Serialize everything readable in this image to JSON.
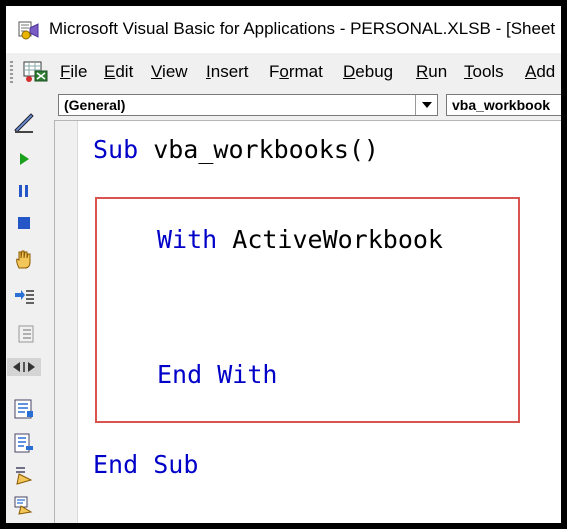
{
  "window": {
    "title": "Microsoft Visual Basic for Applications - PERSONAL.XLSB - [Sheet"
  },
  "menu": {
    "items": [
      {
        "key": "file",
        "text": "File"
      },
      {
        "key": "edit",
        "text": "Edit"
      },
      {
        "key": "view",
        "text": "View"
      },
      {
        "key": "insert",
        "text": "Insert"
      },
      {
        "key": "format",
        "text": "Format"
      },
      {
        "key": "debug",
        "text": "Debug"
      },
      {
        "key": "run",
        "text": "Run"
      },
      {
        "key": "tools",
        "text": "Tools"
      },
      {
        "key": "addins",
        "text": "Add"
      }
    ]
  },
  "toolbar_icons": [
    "design-mode-icon",
    "run-icon",
    "break-icon",
    "reset-icon",
    "hand-icon",
    "indent-icon",
    "outdent-icon",
    "toggle-icon",
    "list-properties-icon",
    "list-constants-icon",
    "quick-info-icon",
    "parameter-info-icon"
  ],
  "combos": {
    "object": "(General)",
    "procedure": "vba_workbook"
  },
  "code": {
    "line1_kw": "Sub",
    "line1_rest": " vba_workbooks()",
    "line2_kw": "With",
    "line2_rest": " ActiveWorkbook",
    "line3_kw1": "End",
    "line3_kw2": "With",
    "line4_kw1": "End",
    "line4_kw2": "Sub"
  },
  "colors": {
    "keyword": "#0000c8",
    "highlight_border": "#d9534f"
  }
}
